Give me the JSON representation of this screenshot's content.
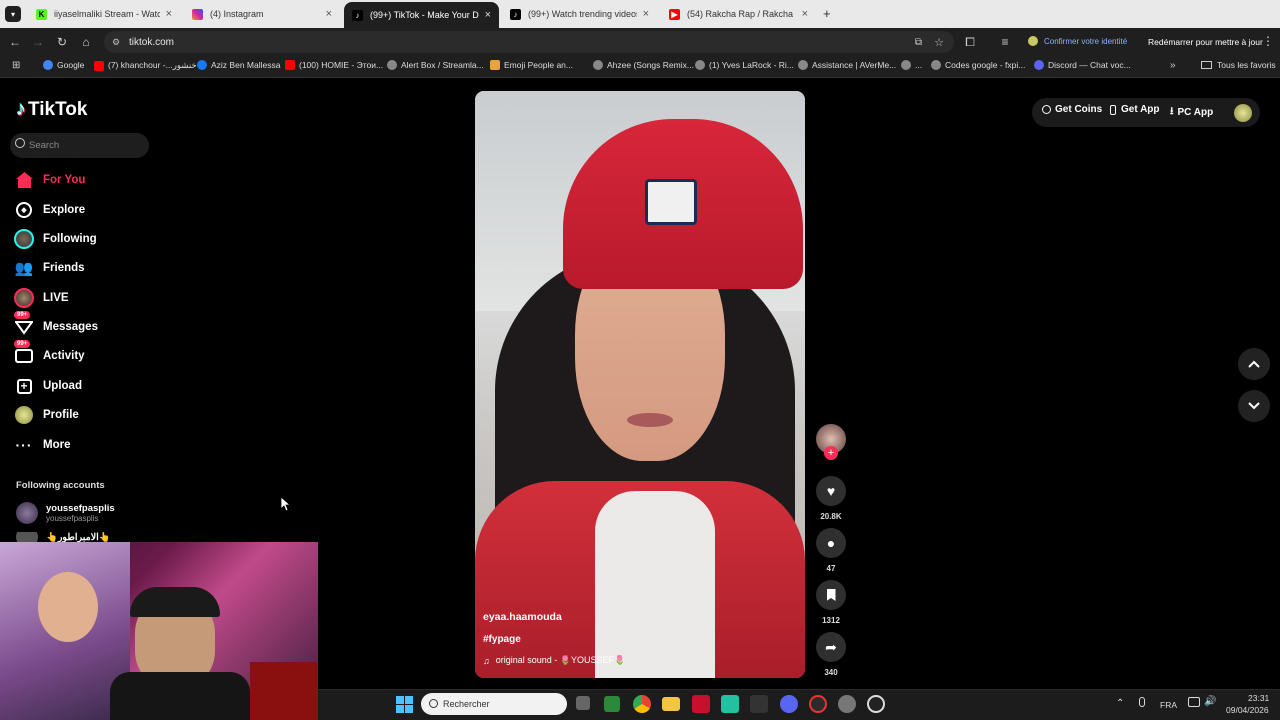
{
  "tabs": [
    {
      "title": "iiyaselmaliki Stream - Watch Li",
      "icon": "kick-icon",
      "color": "#53fc18"
    },
    {
      "title": "(4) Instagram",
      "icon": "instagram-icon",
      "color": "#d6249f"
    },
    {
      "title": "(99+) TikTok - Make Your Day",
      "icon": "tiktok-icon",
      "color": "#000000",
      "active": true
    },
    {
      "title": "(99+) Watch trending videos for",
      "icon": "tiktok-icon",
      "color": "#000000"
    },
    {
      "title": "(54) Rakcha Rap / Rakcha Prod",
      "icon": "youtube-icon",
      "color": "#ff0000"
    }
  ],
  "toolbar": {
    "url": "tiktok.com",
    "identity": "Confirmer votre identité",
    "restart": "Redémarrer pour mettre à jour"
  },
  "bookmarks": [
    {
      "label": "Google",
      "color": "#4285f4"
    },
    {
      "label": "(7) khanchour -...خنشور",
      "color": "#ff0000"
    },
    {
      "label": "Aziz Ben Mallessa",
      "color": "#1877f2"
    },
    {
      "label": "(100) HOMIE - Этои...",
      "color": "#ff0000"
    },
    {
      "label": "Alert Box / Streamla...",
      "color": "#888888"
    },
    {
      "label": "Emoji People an...",
      "color": "#e8a33d"
    },
    {
      "label": "Ahzee (Songs Remix...",
      "color": "#888888"
    },
    {
      "label": "(1) Yves LaRock - Ri...",
      "color": "#888888"
    },
    {
      "label": "Assistance | AVerMe...",
      "color": "#888888"
    },
    {
      "label": "...",
      "color": "#888888"
    },
    {
      "label": "Codes google - fxpi...",
      "color": "#888888"
    },
    {
      "label": "Discord — Chat voc...",
      "color": "#5865f2"
    }
  ],
  "bookmarks_all": "Tous les favoris",
  "tiktok": {
    "logo": "TikTok",
    "search_placeholder": "Search",
    "nav": [
      {
        "label": "For You",
        "icon": "home-icon",
        "active": true
      },
      {
        "label": "Explore",
        "icon": "compass-icon"
      },
      {
        "label": "Following",
        "icon": "following-icon"
      },
      {
        "label": "Friends",
        "icon": "friends-icon"
      },
      {
        "label": "LIVE",
        "icon": "live-icon"
      },
      {
        "label": "Messages",
        "icon": "messages-icon",
        "badge": "99+"
      },
      {
        "label": "Activity",
        "icon": "activity-icon",
        "badge": "99+"
      },
      {
        "label": "Upload",
        "icon": "upload-icon"
      },
      {
        "label": "Profile",
        "icon": "profile-icon"
      },
      {
        "label": "More",
        "icon": "more-icon"
      }
    ],
    "following_title": "Following accounts",
    "following": [
      {
        "name": "youssefpasplis",
        "handle": "youssefpasplis"
      },
      {
        "name": "👆الامبراطور👆",
        "handle": ""
      }
    ],
    "top_buttons": {
      "coins": "Get Coins",
      "app": "Get App",
      "pc": "PC App"
    },
    "video": {
      "username": "eyaa.haamouda",
      "hashtag": "#fypage",
      "sound": "original sound - 🌷YOUSSEF🌷"
    },
    "actions": {
      "likes": "20.8K",
      "comments": "47",
      "saves": "1312",
      "shares": "340"
    }
  },
  "taskbar": {
    "search_placeholder": "Rechercher",
    "lang": "FRA",
    "time": "23:31",
    "date": "09/04/2026"
  }
}
